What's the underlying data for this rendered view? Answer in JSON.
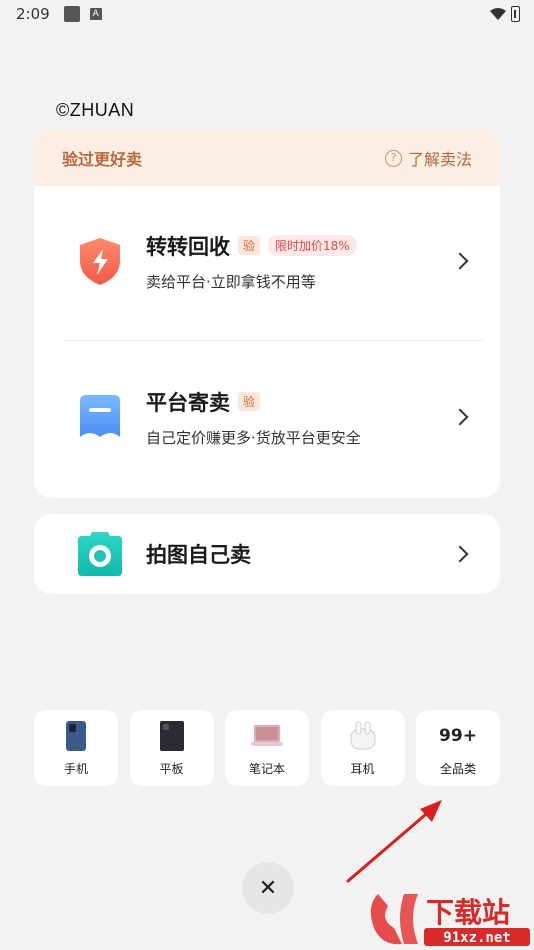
{
  "status_bar": {
    "time": "2:09",
    "notification_letter": "A"
  },
  "watermark": "©ZHUAN",
  "banner": {
    "title": "验过更好卖",
    "learn_label": "了解卖法",
    "help_glyph": "?"
  },
  "options": [
    {
      "title": "转转回收",
      "tag": "验",
      "bonus": "限时加价18%",
      "subtitle": "卖给平台·立即拿钱不用等",
      "icon": "shield-bolt-icon"
    },
    {
      "title": "平台寄卖",
      "tag": "验",
      "subtitle": "自己定价赚更多·货放平台更安全",
      "icon": "consign-box-icon"
    }
  ],
  "photo_sell": {
    "title": "拍图自己卖",
    "icon": "camera-icon"
  },
  "categories": [
    {
      "label": "手机",
      "icon": "phone-icon"
    },
    {
      "label": "平板",
      "icon": "tablet-icon"
    },
    {
      "label": "笔记本",
      "icon": "laptop-icon"
    },
    {
      "label": "耳机",
      "icon": "earbuds-icon"
    },
    {
      "label": "全品类",
      "count": "99+"
    }
  ],
  "close_glyph": "✕",
  "site_logo": {
    "text": "下载站",
    "url_text": "91xz.net"
  },
  "colors": {
    "accent": "#b46a3c",
    "banner_bg": "#fdeee4",
    "bonus_red": "#e24848",
    "annotation_arrow": "#d81e1e"
  }
}
